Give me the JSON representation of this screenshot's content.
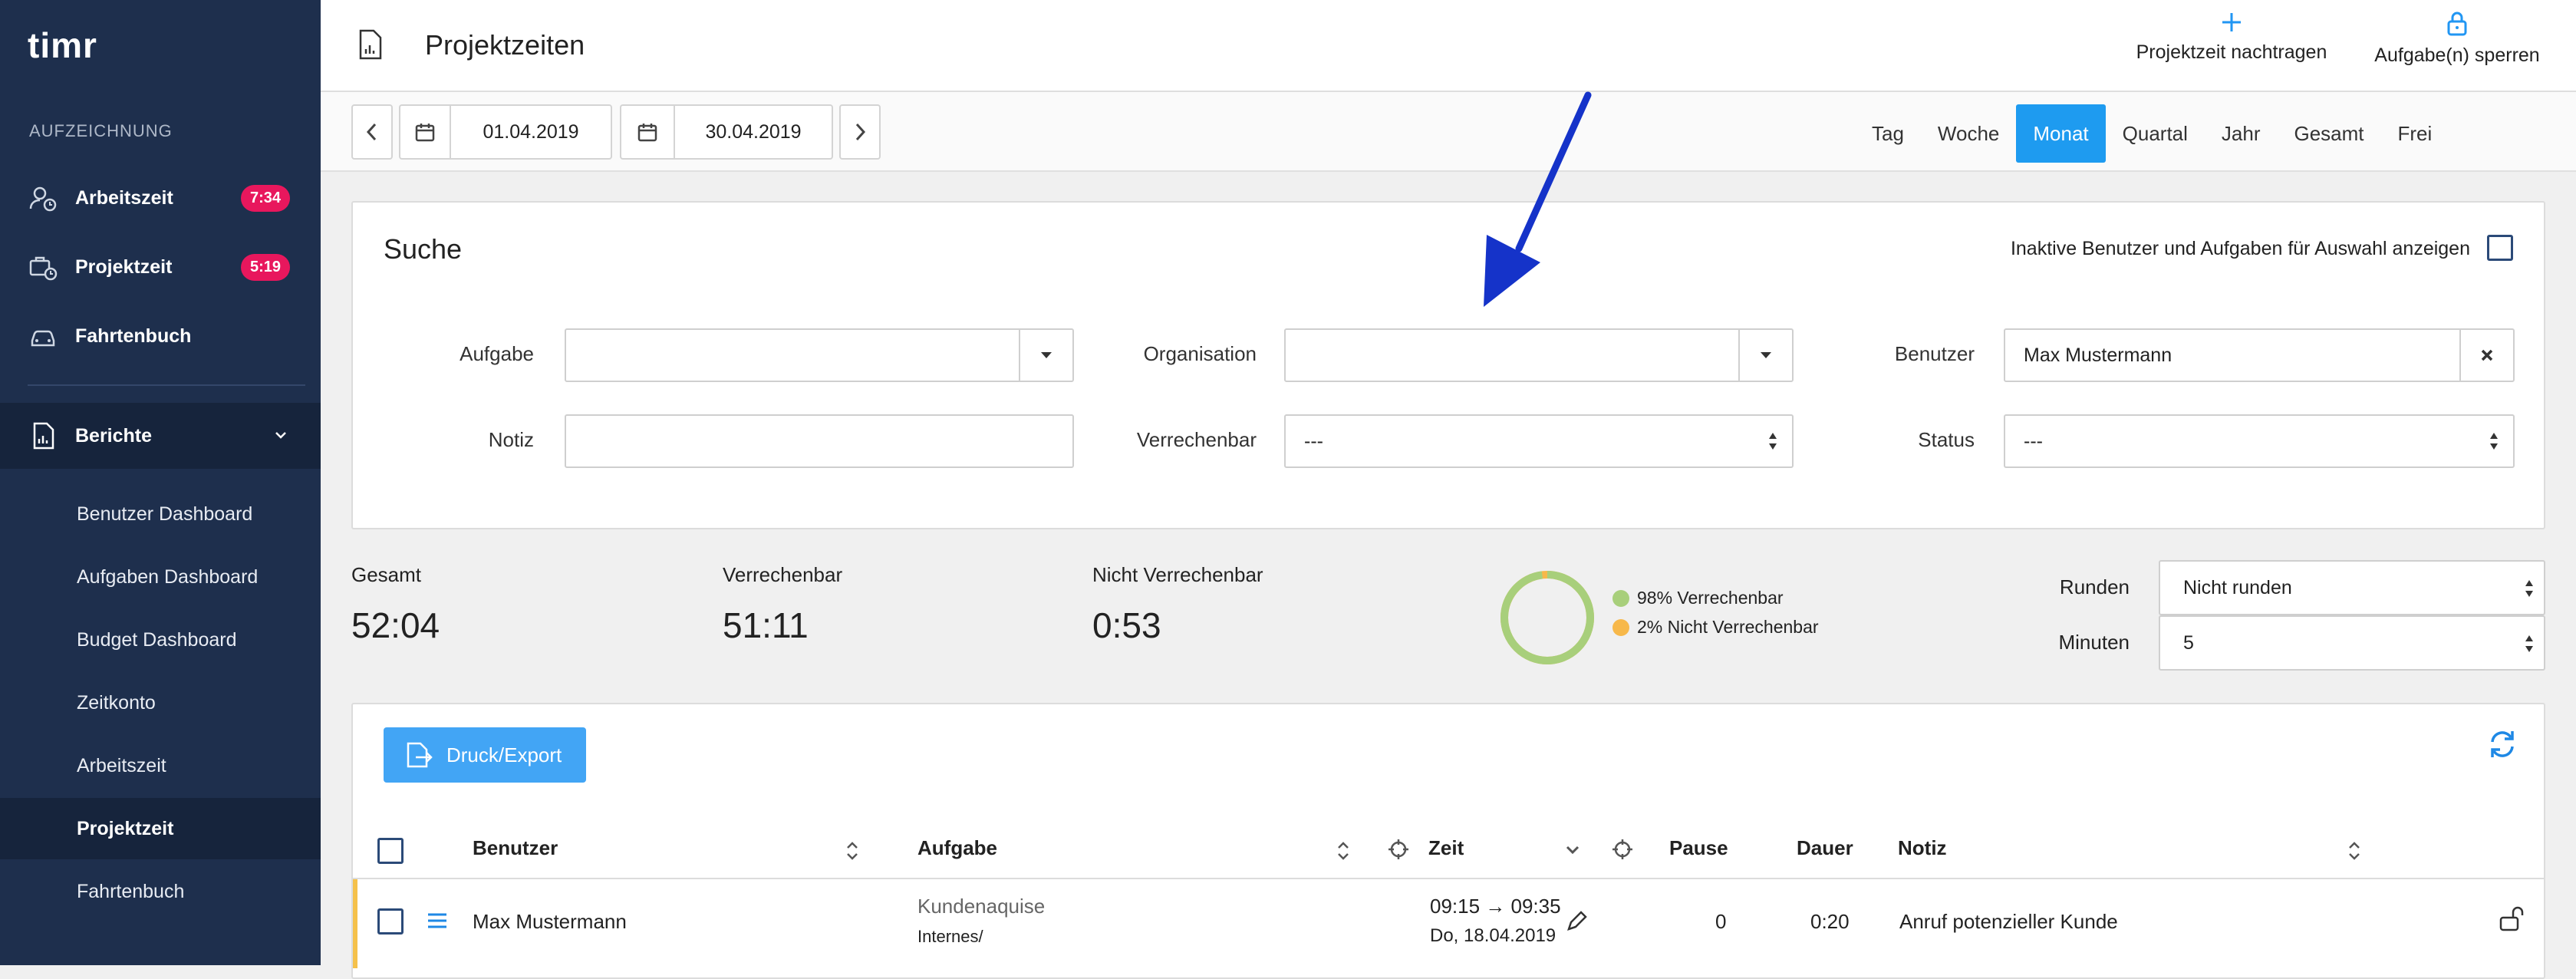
{
  "sidebar": {
    "logo": "timr",
    "section_label": "AUFZEICHNUNG",
    "items": [
      {
        "label": "Arbeitszeit",
        "badge": "7:34",
        "icon": "user-clock-icon"
      },
      {
        "label": "Projektzeit",
        "badge": "5:19",
        "icon": "project-clock-icon"
      },
      {
        "label": "Fahrtenbuch",
        "badge": "",
        "icon": "car-icon"
      }
    ],
    "reports": {
      "label": "Berichte",
      "icon": "report-icon",
      "items": [
        "Benutzer Dashboard",
        "Aufgaben Dashboard",
        "Budget Dashboard",
        "Zeitkonto",
        "Arbeitszeit",
        "Projektzeit",
        "Fahrtenbuch"
      ],
      "active": "Projektzeit"
    }
  },
  "header": {
    "title": "Projektzeiten",
    "add_label": "Projektzeit nachtragen",
    "lock_label": "Aufgabe(n) sperren"
  },
  "toolbar": {
    "date_from": "01.04.2019",
    "date_to": "30.04.2019",
    "periods": [
      "Tag",
      "Woche",
      "Monat",
      "Quartal",
      "Jahr",
      "Gesamt",
      "Frei"
    ],
    "active_period": "Monat"
  },
  "search": {
    "title": "Suche",
    "inactive_label": "Inaktive Benutzer und Aufgaben für Auswahl anzeigen",
    "inactive_checked": false,
    "fields": {
      "aufgabe_label": "Aufgabe",
      "aufgabe_value": "",
      "organisation_label": "Organisation",
      "organisation_value": "",
      "benutzer_label": "Benutzer",
      "benutzer_value": "Max Mustermann",
      "notiz_label": "Notiz",
      "notiz_value": "",
      "verrechenbar_label": "Verrechenbar",
      "verrechenbar_value": "---",
      "status_label": "Status",
      "status_value": "---"
    }
  },
  "stats": {
    "gesamt_label": "Gesamt",
    "gesamt_value": "52:04",
    "verrechenbar_label": "Verrechenbar",
    "verrechenbar_value": "51:11",
    "nicht_label": "Nicht Verrechenbar",
    "nicht_value": "0:53",
    "legend_billable": "98% Verrechenbar",
    "legend_nonbillable": "2% Nicht Verrechenbar",
    "billable_fraction": 0.98,
    "color_billable": "#a8cf7b",
    "color_nonbillable": "#f7b84a",
    "runden_label": "Runden",
    "runden_value": "Nicht runden",
    "minuten_label": "Minuten",
    "minuten_value": "5"
  },
  "table": {
    "export_label": "Druck/Export",
    "columns": {
      "benutzer": "Benutzer",
      "aufgabe": "Aufgabe",
      "zeit": "Zeit",
      "pause": "Pause",
      "dauer": "Dauer",
      "notiz": "Notiz"
    },
    "rows": [
      {
        "benutzer": "Max Mustermann",
        "aufgabe": "Kundenaquise",
        "aufgabe_path": "Internes/",
        "zeit": "09:15 → 09:35",
        "datum": "Do, 18.04.2019",
        "pause": "0",
        "dauer": "0:20",
        "notiz": "Anruf potenzieller Kunde"
      }
    ]
  },
  "colors": {
    "sidebar_bg": "#1e2f4d",
    "accent": "#1e9bf0",
    "badge": "#e8175d",
    "annotation_arrow": "#1533c9"
  }
}
